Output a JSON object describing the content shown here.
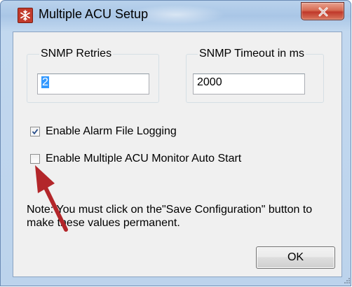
{
  "window": {
    "title": "Multiple ACU Setup",
    "close_glyph": "X",
    "app_icon": "snowflake-icon"
  },
  "snmp_retries": {
    "label": "SNMP Retries",
    "value": "2"
  },
  "snmp_timeout": {
    "label": "SNMP Timeout in ms",
    "value": "2000"
  },
  "checkboxes": [
    {
      "label": "Enable Alarm File Logging",
      "checked": true
    },
    {
      "label": "Enable Multiple ACU Monitor Auto Start",
      "checked": false
    }
  ],
  "note": "Note: You must click on the\"Save Configuration\" button to make these values permanent.",
  "buttons": {
    "ok": "OK"
  },
  "annotation": {
    "arrow_color": "#b3262a"
  }
}
